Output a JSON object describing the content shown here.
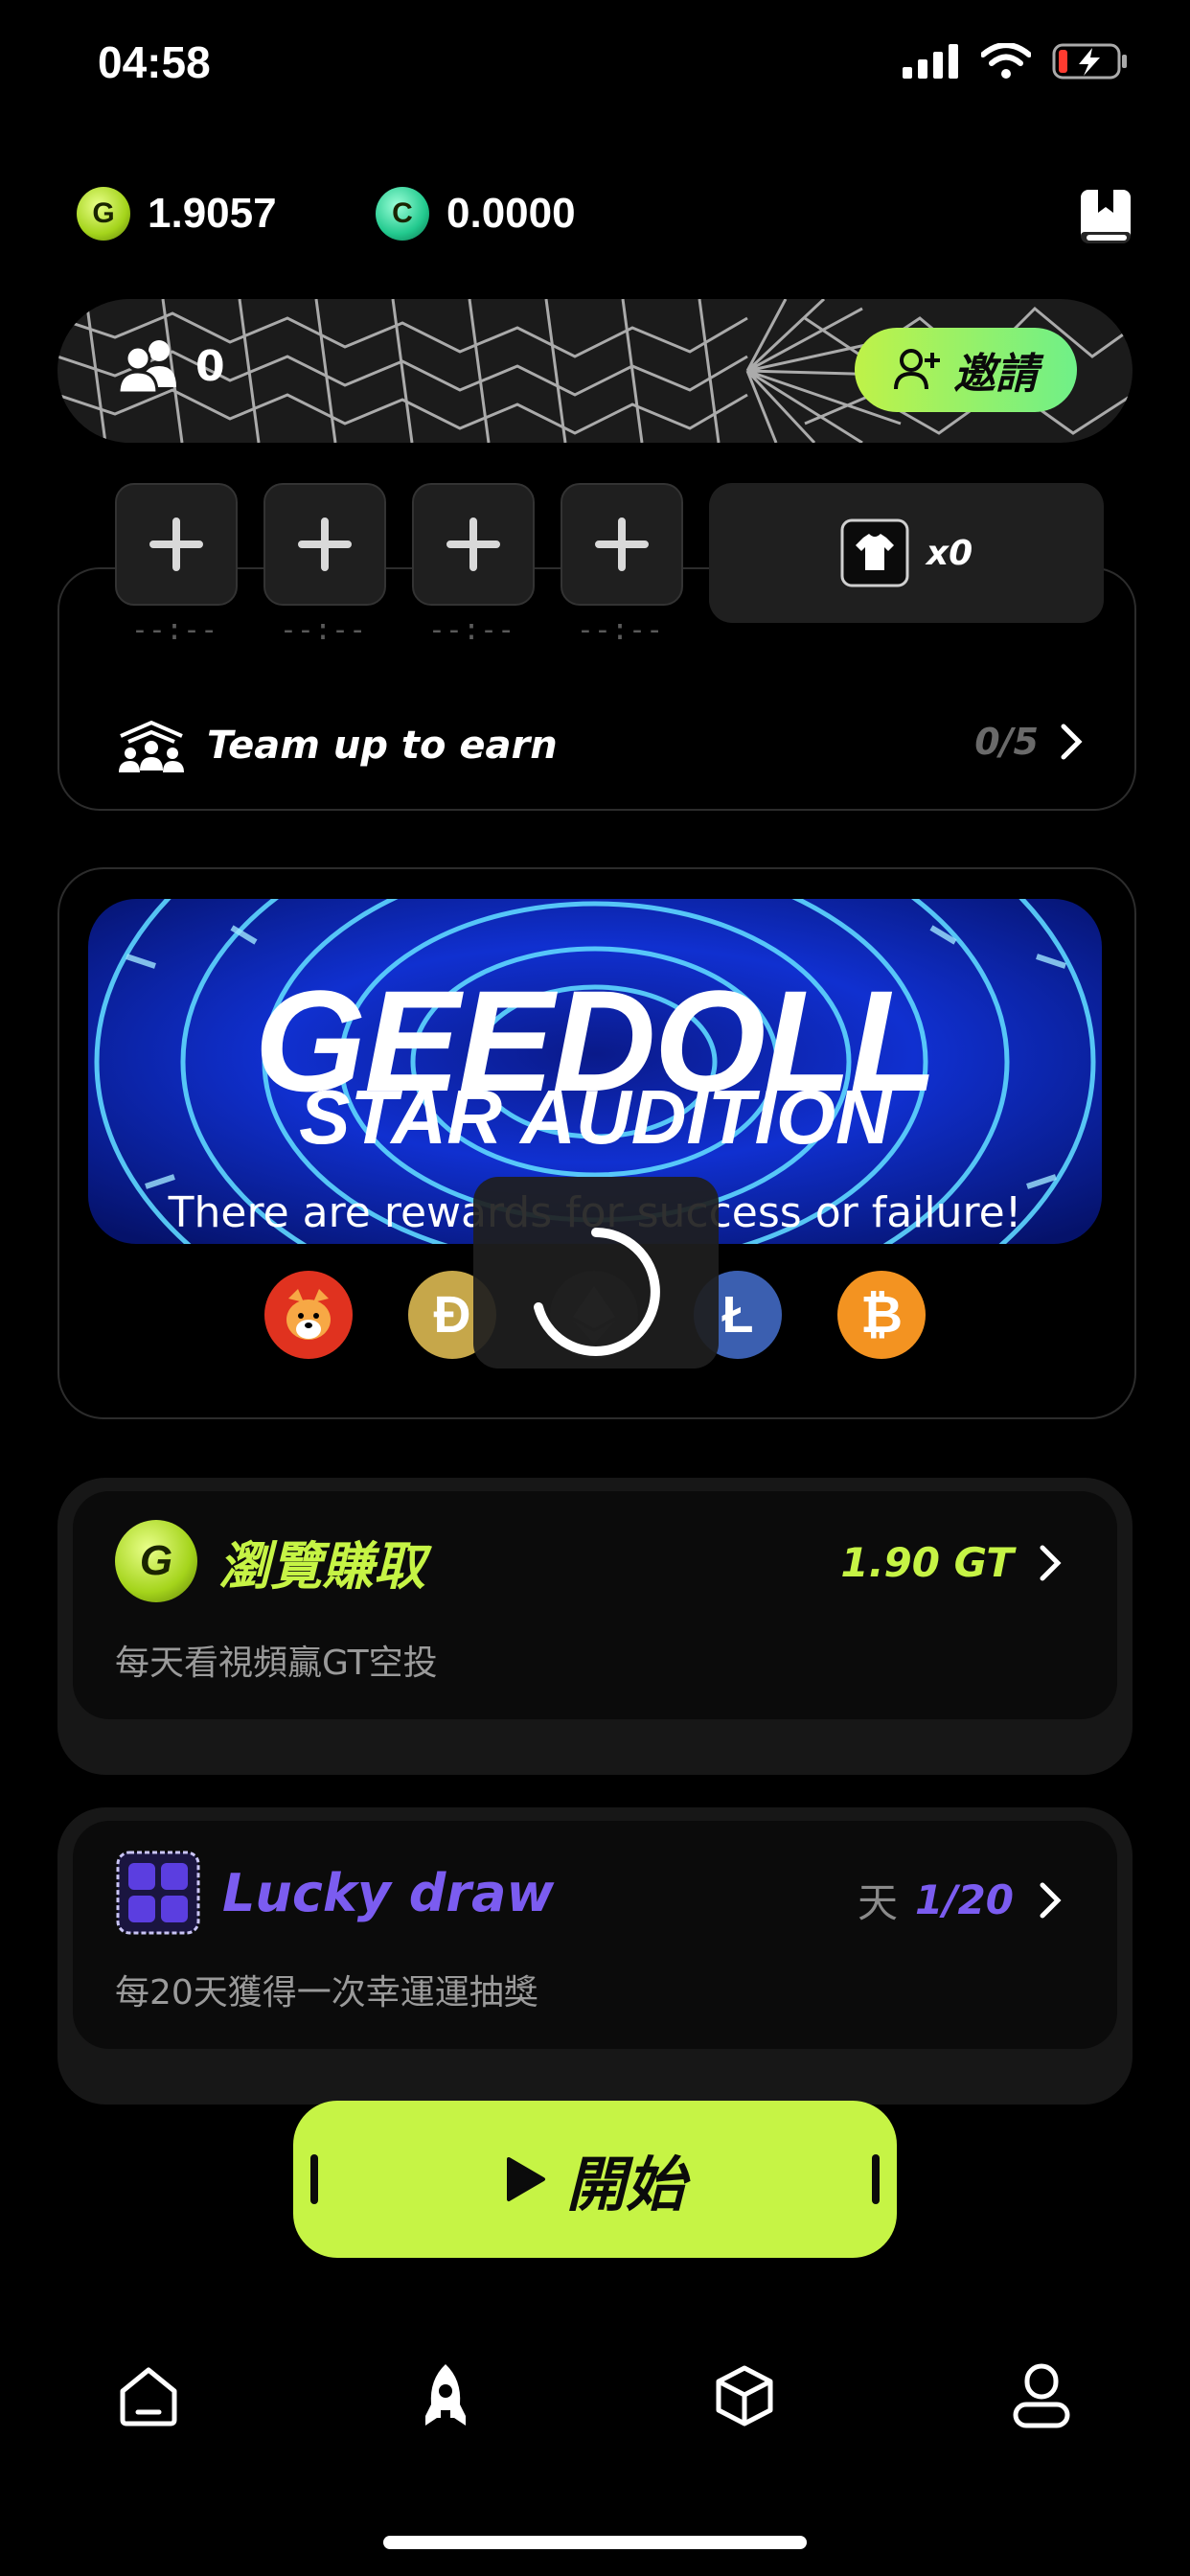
{
  "status": {
    "time": "04:58"
  },
  "balances": [
    {
      "icon": "gt-coin-icon",
      "value": "1.9057"
    },
    {
      "icon": "gc-coin-icon",
      "value": "0.0000"
    }
  ],
  "team": {
    "members": "0",
    "invite_label": "邀請",
    "slots": [
      "--:--",
      "--:--",
      "--:--",
      "--:--"
    ],
    "shirt_count": "x0",
    "label": "Team up to earn",
    "progress": "0/5"
  },
  "promo": {
    "title_line1": "GEEDOLL",
    "title_line2": "STAR AUDITION",
    "subtitle": "There are rewards for success or failure!",
    "coins": [
      {
        "icon": "shiba-inu-coin-icon",
        "color": "#e0321f"
      },
      {
        "icon": "dogecoin-icon",
        "symbol": "Ð",
        "color": "#c6a74a"
      },
      {
        "icon": "ethereum-coin-icon",
        "color": "#2a2a2a"
      },
      {
        "icon": "litecoin-icon",
        "symbol": "Ł",
        "color": "#3b5fb0"
      },
      {
        "icon": "bitcoin-icon",
        "symbol": "₿",
        "color": "#f39321"
      }
    ]
  },
  "tasks": {
    "browse": {
      "title": "瀏覽賺取",
      "reward": "1.90 GT",
      "desc": "每天看視頻贏GT空投",
      "accent": "#c6f445"
    },
    "lucky": {
      "title": "Lucky draw",
      "unit": "天",
      "progress": "1/20",
      "desc": "每20天獲得一次幸運運抽獎",
      "accent": "#7b5cf0"
    }
  },
  "start_button": {
    "label": "開始"
  },
  "nav": [
    "home-icon",
    "rocket-icon",
    "box-icon",
    "profile-icon"
  ]
}
